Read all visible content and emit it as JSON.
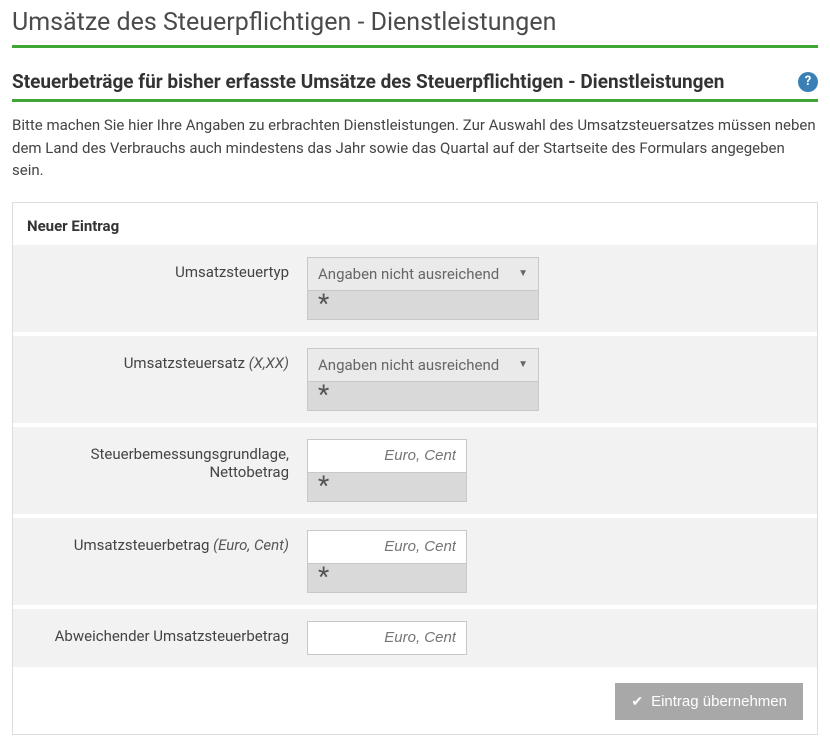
{
  "page_title": "Umsätze des Steuerpflichtigen - Dienstleistungen",
  "section": {
    "title": "Steuerbeträge für bisher erfasste Umsätze des Steuerpflichtigen - Dienstleistungen",
    "help_glyph": "?"
  },
  "intro": "Bitte machen Sie hier Ihre Angaben zu erbrachten Dienstleistungen. Zur Auswahl des Umsatzsteuersatzes müssen neben dem Land des Verbrauchs auch mindestens das Jahr sowie das Quartal auf der Startseite des Formulars angegeben sein.",
  "entry": {
    "title": "Neuer Eintrag",
    "fields": {
      "ust_typ": {
        "label": "Umsatzsteuertyp",
        "selected": "Angaben nicht ausreichend",
        "mandatory_mark": "*"
      },
      "ust_satz": {
        "label_main": "Umsatzsteuersatz ",
        "label_em": "(X,XX)",
        "selected": "Angaben nicht ausreichend",
        "mandatory_mark": "*"
      },
      "bemessung": {
        "label_main": "Steuerbemessungsgrundlage, Nettobetrag",
        "placeholder": "Euro, Cent",
        "mandatory_mark": "*"
      },
      "ust_betrag": {
        "label_main": "Umsatzsteuerbetrag ",
        "label_em": "(Euro, Cent)",
        "placeholder": "Euro, Cent",
        "mandatory_mark": "*"
      },
      "abweichend": {
        "label": "Abweichender Umsatzsteuerbetrag",
        "placeholder": "Euro, Cent"
      }
    },
    "submit_label": "Eintrag übernehmen",
    "submit_check": "✔"
  }
}
